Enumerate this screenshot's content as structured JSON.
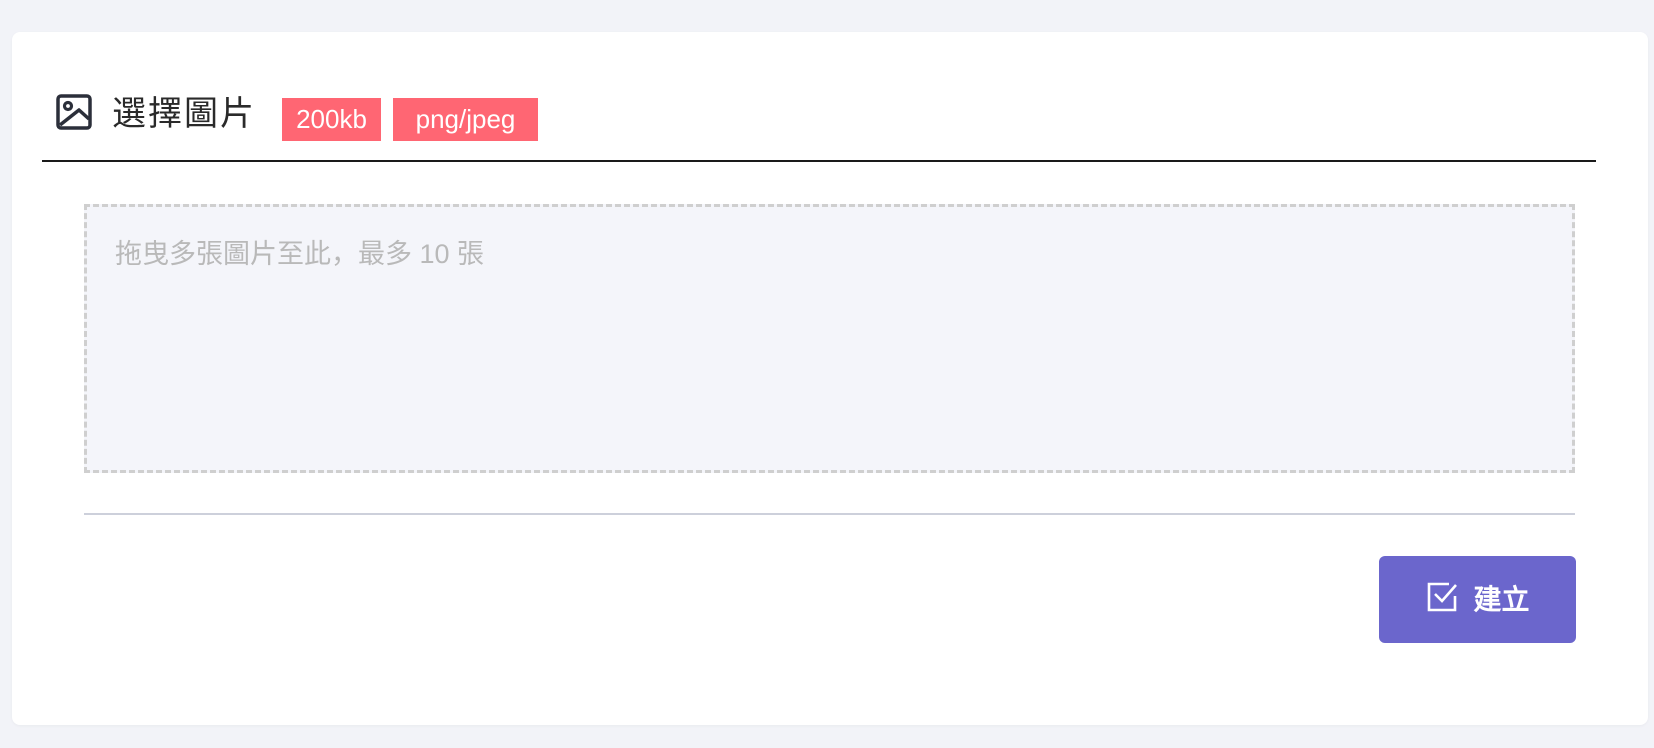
{
  "header": {
    "icon": "image-icon",
    "title": "選擇圖片",
    "tags": [
      {
        "label": "200kb",
        "color": "#ff6673"
      },
      {
        "label": "png/jpeg",
        "color": "#ff6673"
      }
    ]
  },
  "dropzone": {
    "placeholder": "拖曳多張圖片至此，最多 10 張"
  },
  "actions": {
    "create_label": "建立",
    "create_icon": "checkbox-check-icon",
    "button_color": "#6b66cc"
  }
}
